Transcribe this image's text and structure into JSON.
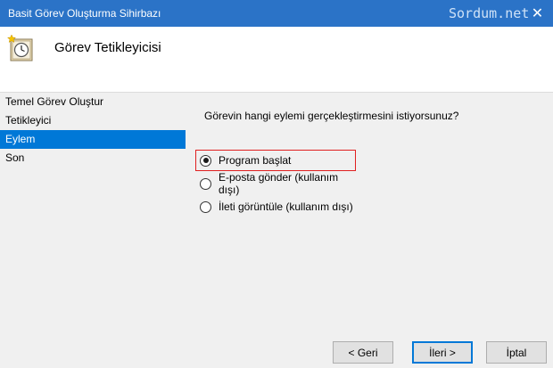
{
  "window": {
    "title": "Basit Görev Oluşturma Sihirbazı",
    "watermark": "Sordum.net",
    "close_glyph": "✕"
  },
  "header": {
    "icon": "wizard-clock-icon",
    "title": "Görev Tetikleyicisi"
  },
  "steps": [
    {
      "label": "Temel Görev Oluştur",
      "active": false
    },
    {
      "label": "Tetikleyici",
      "active": false
    },
    {
      "label": "Eylem",
      "active": true
    },
    {
      "label": "Son",
      "active": false
    }
  ],
  "main": {
    "question": "Görevin hangi eylemi gerçekleştirmesini istiyorsunuz?",
    "options": [
      {
        "label": "Program başlat",
        "checked": true
      },
      {
        "label": "E-posta gönder (kullanım dışı)",
        "checked": false
      },
      {
        "label": "İleti görüntüle (kullanım dışı)",
        "checked": false
      }
    ]
  },
  "buttons": {
    "back": "< Geri",
    "next": "İleri >",
    "cancel": "İptal"
  },
  "colors": {
    "titlebar": "#2b73c7",
    "selected_step": "#0078d7",
    "highlight_border": "#e02020"
  }
}
